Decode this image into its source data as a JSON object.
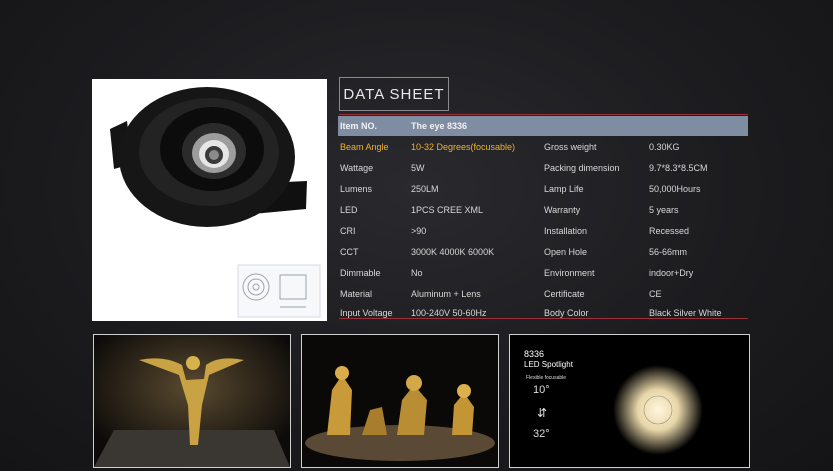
{
  "datasheet": {
    "title": "DATA SHEET",
    "header": {
      "label1": "Item NO.",
      "value1": "The eye 8336"
    },
    "rows": [
      {
        "label1": "Beam Angle",
        "value1": "10-32 Degrees(focusable)",
        "label2": "Gross weight",
        "value2": "0.30KG"
      },
      {
        "label1": "Wattage",
        "value1": "5W",
        "label2": "Packing dimension",
        "value2": "9.7*8.3*8.5CM"
      },
      {
        "label1": "Lumens",
        "value1": "250LM",
        "label2": "Lamp Life",
        "value2": "50,000Hours"
      },
      {
        "label1": "LED",
        "value1": "1PCS CREE XML",
        "label2": "Warranty",
        "value2": "5 years"
      },
      {
        "label1": "CRI",
        "value1": ">90",
        "label2": "Installation",
        "value2": "Recessed"
      },
      {
        "label1": "CCT",
        "value1": "3000K 4000K 6000K",
        "label2": "Open Hole",
        "value2": "56-66mm"
      },
      {
        "label1": "Dimmable",
        "value1": "No",
        "label2": "Environment",
        "value2": "indoor+Dry"
      },
      {
        "label1": "Material",
        "value1": "Aluminum + Lens",
        "label2": "Certificate",
        "value2": "CE"
      },
      {
        "label1": "Input Voltage",
        "value1": "100-240V 50-60Hz",
        "label2": "Body Color",
        "value2": "Black Silver White"
      }
    ]
  },
  "spotlight_card": {
    "code": "8336",
    "name": "LED Spotlight",
    "flexible": "Flexible focusable",
    "angle_min": "10°",
    "angle_max": "32°"
  },
  "colors": {
    "accent_rule": "#9b3036",
    "header_bg": "#7f8da2",
    "highlight": "#f0b128"
  }
}
